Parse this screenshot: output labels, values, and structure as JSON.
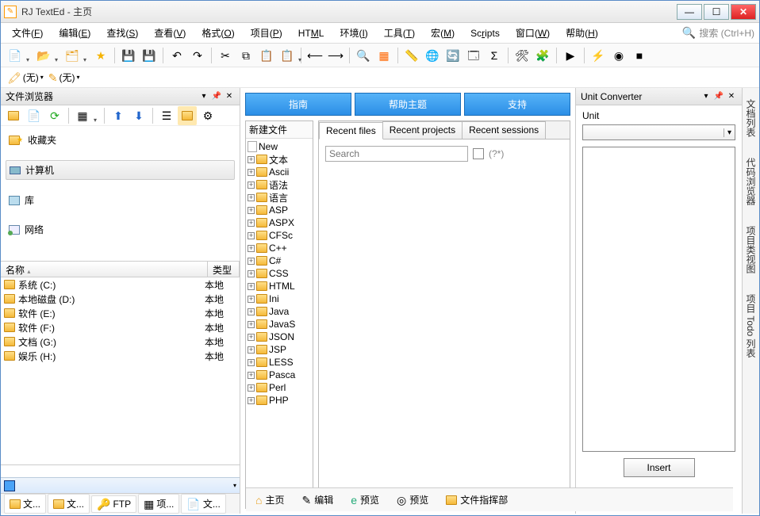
{
  "window": {
    "title": "RJ TextEd - 主页"
  },
  "winbtns": {
    "min": "—",
    "max": "☐",
    "close": "✕"
  },
  "menu": {
    "items": [
      {
        "l": "文件",
        "k": "F"
      },
      {
        "l": "编辑",
        "k": "E"
      },
      {
        "l": "查找",
        "k": "S"
      },
      {
        "l": "查看",
        "k": "V"
      },
      {
        "l": "格式",
        "k": "O"
      },
      {
        "l": "项目",
        "k": "P"
      },
      {
        "l": "HTML",
        "k": ""
      },
      {
        "l": "环境",
        "k": "I"
      },
      {
        "l": "工具",
        "k": "T"
      },
      {
        "l": "宏",
        "k": "M"
      },
      {
        "l": "Scripts",
        "k": ""
      },
      {
        "l": "窗口",
        "k": "W"
      },
      {
        "l": "帮助",
        "k": "H"
      }
    ],
    "search_placeholder": "搜索 (Ctrl+H)"
  },
  "toolbar2": {
    "none1": "(无)",
    "none2": "(无)"
  },
  "left": {
    "title": "文件浏览器",
    "tree": {
      "fav": "收藏夹",
      "computer": "计算机",
      "library": "库",
      "network": "网络"
    },
    "listhdr": {
      "name": "名称",
      "type": "类型"
    },
    "drives": [
      {
        "n": "系统 (C:)",
        "t": "本地"
      },
      {
        "n": "本地磁盘 (D:)",
        "t": "本地"
      },
      {
        "n": "软件 (E:)",
        "t": "本地"
      },
      {
        "n": "软件 (F:)",
        "t": "本地"
      },
      {
        "n": "文档 (G:)",
        "t": "本地"
      },
      {
        "n": "娱乐 (H:)",
        "t": "本地"
      }
    ],
    "tabs": {
      "t1": "文...",
      "t2": "文...",
      "t3": "FTP",
      "t4": "项...",
      "t5": "文..."
    }
  },
  "center": {
    "tabs": {
      "guide": "指南",
      "help": "帮助主题",
      "support": "支持"
    },
    "newfile": {
      "title": "新建文件",
      "items": [
        "New",
        "文本",
        "Ascii",
        "语法",
        "语言",
        "ASP",
        "ASPX",
        "CFSc",
        "C++",
        "C#",
        "CSS",
        "HTML",
        "Ini",
        "Java",
        "JavaS",
        "JSON",
        "JSP",
        "LESS",
        "Pasca",
        "Perl",
        "PHP"
      ]
    },
    "recent_tabs": {
      "files": "Recent files",
      "projects": "Recent projects",
      "sessions": "Recent sessions"
    },
    "search_ph": "Search",
    "regex_lbl": "(?*)",
    "bottom_tabs": {
      "home": "主页",
      "edit": "编辑",
      "preview1": "预览",
      "preview2": "预览",
      "conductor": "文件指挥部"
    }
  },
  "right": {
    "title": "Unit Converter",
    "unit": "Unit",
    "insert": "Insert"
  },
  "sidetabs": [
    "文档列表",
    "代码浏览器",
    "项目类视图",
    "项目 Todo 列表"
  ]
}
